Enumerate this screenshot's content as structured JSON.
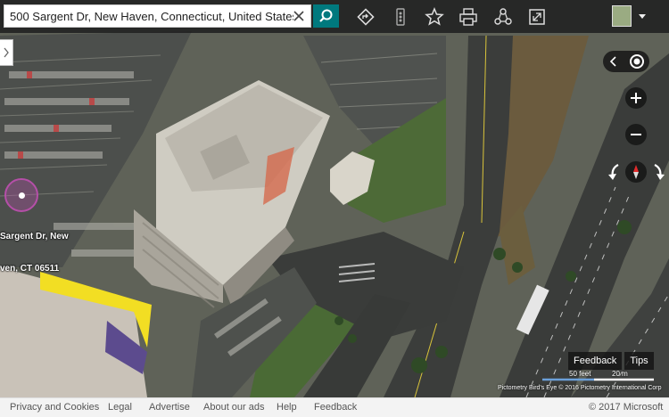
{
  "search": {
    "value": "500 Sargent Dr, New Haven, Connecticut, United States"
  },
  "toolbar": {
    "icons": [
      "directions-icon",
      "traffic-icon",
      "favorites-star-icon",
      "print-icon",
      "share-icon",
      "fullscreen-icon",
      "streetside-icon",
      "menu-caret-icon"
    ]
  },
  "map_controls": {
    "icons": [
      "collapse-chevron-icon",
      "locate-me-icon",
      "zoom-in-icon",
      "zoom-out-icon",
      "rotate-left-icon",
      "compass-icon",
      "rotate-right-icon"
    ]
  },
  "pin": {
    "label_line1": "Sargent Dr, New",
    "label_line2": "ven, CT 06511"
  },
  "feedback": {
    "feedback_label": "Feedback",
    "tips_label": "Tips"
  },
  "scale": {
    "feet": "50 feet",
    "meters": "20 m"
  },
  "imagery_credit": "Pictometry Bird's Eye © 2016 Pictometry International Corp",
  "footer": {
    "links": [
      "Privacy and Cookies",
      "Legal",
      "Advertise",
      "About our ads",
      "Help",
      "Feedback"
    ],
    "copyright": "© 2017 Microsoft"
  },
  "colors": {
    "search_button": "#00797e",
    "pin_ring": "#b54fa8",
    "highlight_yellow": "#f4e11a"
  }
}
